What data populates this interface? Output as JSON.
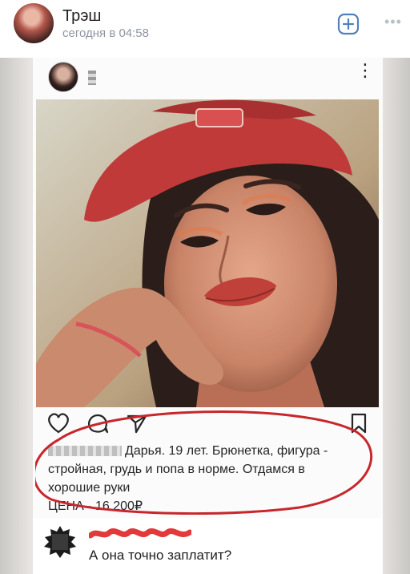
{
  "header": {
    "title": "Трэш",
    "time": "сегодня в 04:58",
    "add_icon": "plus-square-icon",
    "more_icon": "more-horizontal-icon"
  },
  "post": {
    "menu_icon": "more-vertical-icon",
    "actions": [
      "heart-icon",
      "comment-icon",
      "share-icon",
      "bookmark-icon"
    ],
    "caption_line1": "Дарья. 19 лет. Брюнетка, фигура -",
    "caption_line2": "стройная, грудь и попа в норме. Отдамся в",
    "caption_line3": "хорошие руки",
    "caption_price": "ЦЕНА - 16 200₽",
    "highlight_color": "#c7272c"
  },
  "comment": {
    "text": "А она точно заплатит?",
    "name_scribble_color": "#e23a3a"
  },
  "colors": {
    "vk_accent": "#5181b8",
    "time_gray": "#8d96a3"
  }
}
